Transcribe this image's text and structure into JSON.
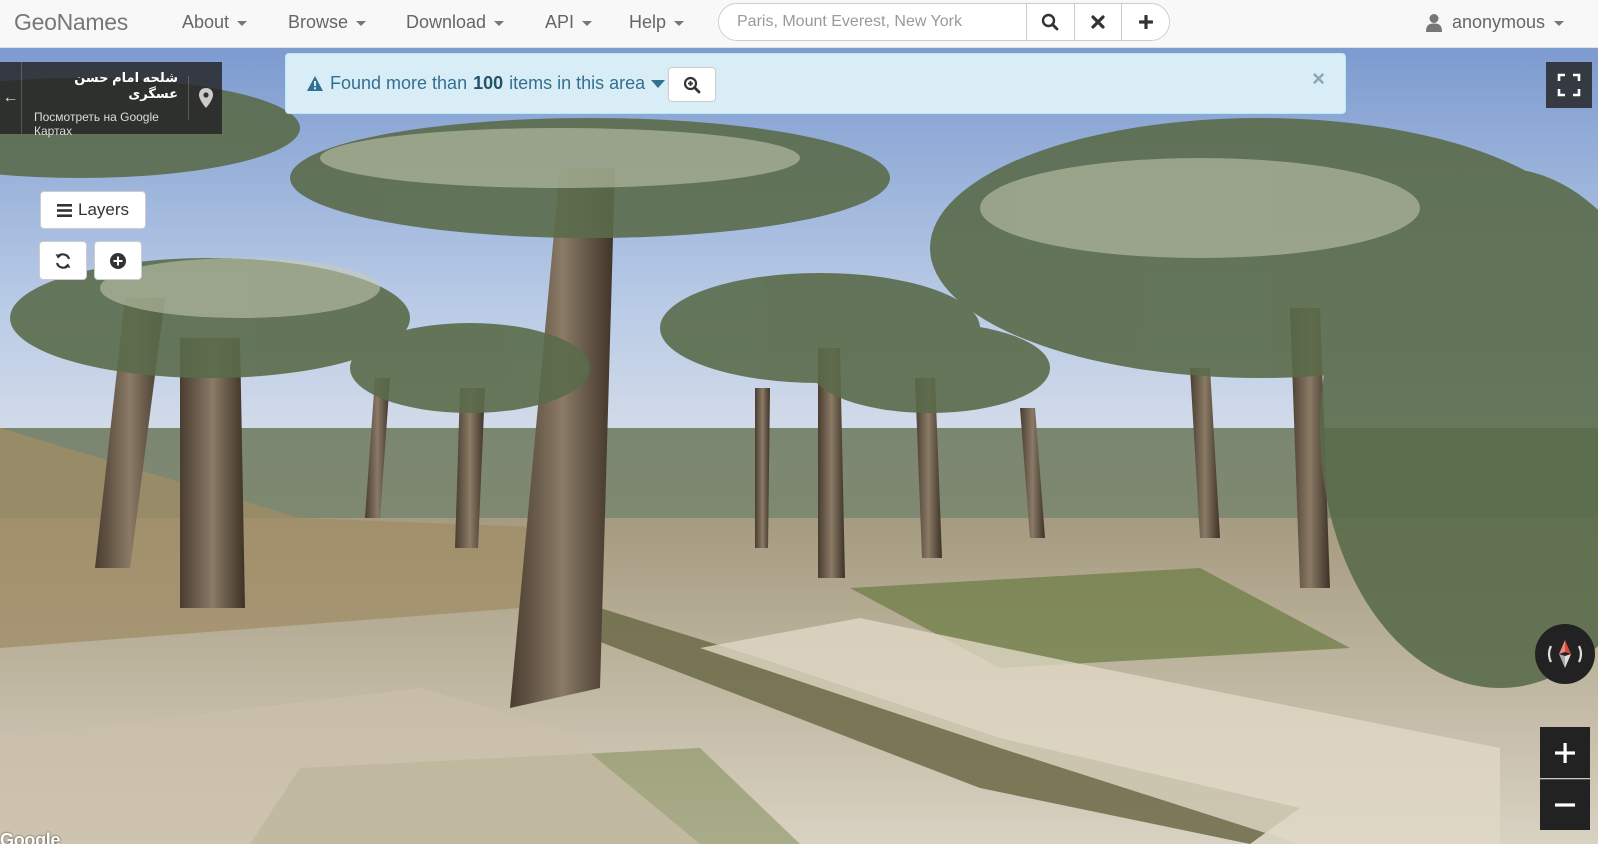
{
  "navbar": {
    "brand": "GeoNames",
    "menu": [
      {
        "label": "About"
      },
      {
        "label": "Browse"
      },
      {
        "label": "Download"
      },
      {
        "label": "API"
      },
      {
        "label": "Help"
      }
    ],
    "search": {
      "placeholder": "Paris, Mount Everest, New York",
      "value": ""
    },
    "search_buttons": [
      "search-icon",
      "times-icon",
      "plus-icon"
    ],
    "user": {
      "label": "anonymous",
      "icon": "user-icon"
    }
  },
  "street_view": {
    "place_title": "شلحه امام حسن عسگری",
    "google_maps_link": "Посмотреть на Google Картах",
    "google_logo": "Google"
  },
  "alert": {
    "text_before": "Found more than",
    "count": "100",
    "text_after": "items in this area",
    "icon": "warning-icon",
    "close": "×"
  },
  "controls": {
    "layers_label": "Layers",
    "icons": [
      "refresh-icon",
      "plus-circle-icon",
      "fullscreen-icon",
      "compass-icon",
      "zoom-in-icon",
      "zoom-out-icon"
    ]
  },
  "colors": {
    "navbar_bg": "#f8f8f8",
    "alert_bg": "#d9edf7",
    "alert_text": "#31708f",
    "control_dark": "#222222"
  }
}
